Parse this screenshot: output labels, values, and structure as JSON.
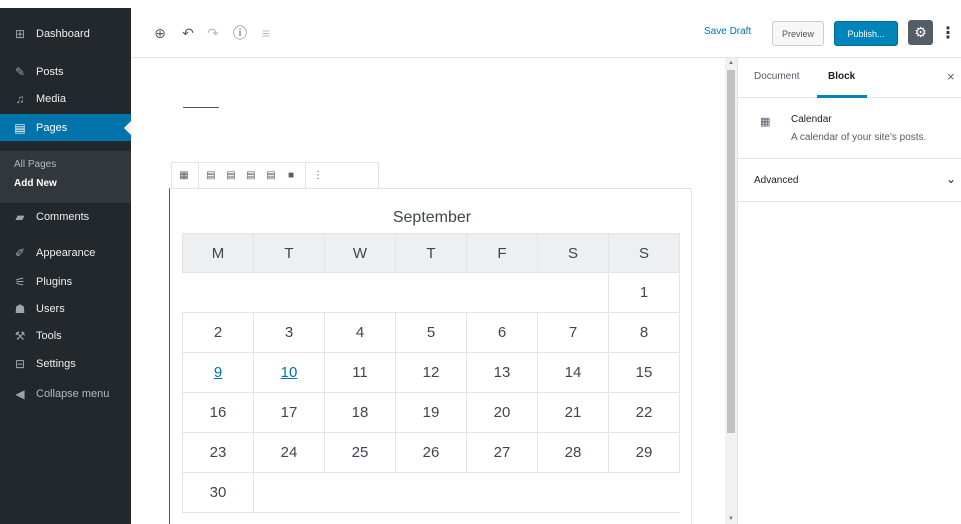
{
  "sidebar": {
    "items": [
      {
        "label": "Dashboard",
        "icon": "dashboard-icon",
        "glyph": "⊞"
      },
      {
        "label": "Posts",
        "icon": "pin-icon",
        "glyph": "✎"
      },
      {
        "label": "Media",
        "icon": "media-icon",
        "glyph": "♫"
      },
      {
        "label": "Pages",
        "icon": "pages-icon",
        "glyph": "▤"
      },
      {
        "label": "Comments",
        "icon": "comments-icon",
        "glyph": "▰"
      },
      {
        "label": "Appearance",
        "icon": "brush-icon",
        "glyph": "✐"
      },
      {
        "label": "Plugins",
        "icon": "plugin-icon",
        "glyph": "⚟"
      },
      {
        "label": "Users",
        "icon": "users-icon",
        "glyph": "☗"
      },
      {
        "label": "Tools",
        "icon": "wrench-icon",
        "glyph": "⚒"
      },
      {
        "label": "Settings",
        "icon": "settings-icon",
        "glyph": "⊟"
      },
      {
        "label": "Collapse menu",
        "icon": "collapse-icon",
        "glyph": "◀"
      }
    ],
    "submenu": {
      "all_pages": "All Pages",
      "add_new": "Add New"
    }
  },
  "header": {
    "icons": {
      "add": "⊕",
      "undo": "↶",
      "redo": "↷",
      "info": "ⓘ",
      "outline": "≡"
    },
    "save_draft": "Save Draft",
    "preview": "Preview",
    "publish": "Publish...",
    "settings_glyph": "⚙",
    "more_glyph": "⋮"
  },
  "block_toolbar": {
    "icons": [
      "▦",
      "▤",
      "▤",
      "▤",
      "▤",
      "■",
      "⋮"
    ]
  },
  "calendar": {
    "caption": "September",
    "weekdays": [
      "M",
      "T",
      "W",
      "T",
      "F",
      "S",
      "S"
    ],
    "weeks": [
      [
        "",
        "",
        "",
        "",
        "",
        "",
        "1"
      ],
      [
        "2",
        "3",
        "4",
        "5",
        "6",
        "7",
        "8"
      ],
      [
        "9",
        "10",
        "11",
        "12",
        "13",
        "14",
        "15"
      ],
      [
        "16",
        "17",
        "18",
        "19",
        "20",
        "21",
        "22"
      ],
      [
        "23",
        "24",
        "25",
        "26",
        "27",
        "28",
        "29"
      ],
      [
        "30",
        "",
        "",
        "",
        "",
        "",
        ""
      ]
    ],
    "linked_days": [
      "9",
      "10"
    ]
  },
  "settings_panel": {
    "tabs": {
      "document": "Document",
      "block": "Block"
    },
    "close_glyph": "×",
    "block_name": "Calendar",
    "block_description": "A calendar of your site's posts.",
    "block_icon_glyph": "▦",
    "advanced": "Advanced",
    "chevron_glyph": "⌄"
  },
  "colors": {
    "admin_bg": "#23282d",
    "accent": "#0073aa",
    "publish": "#0085ba"
  }
}
